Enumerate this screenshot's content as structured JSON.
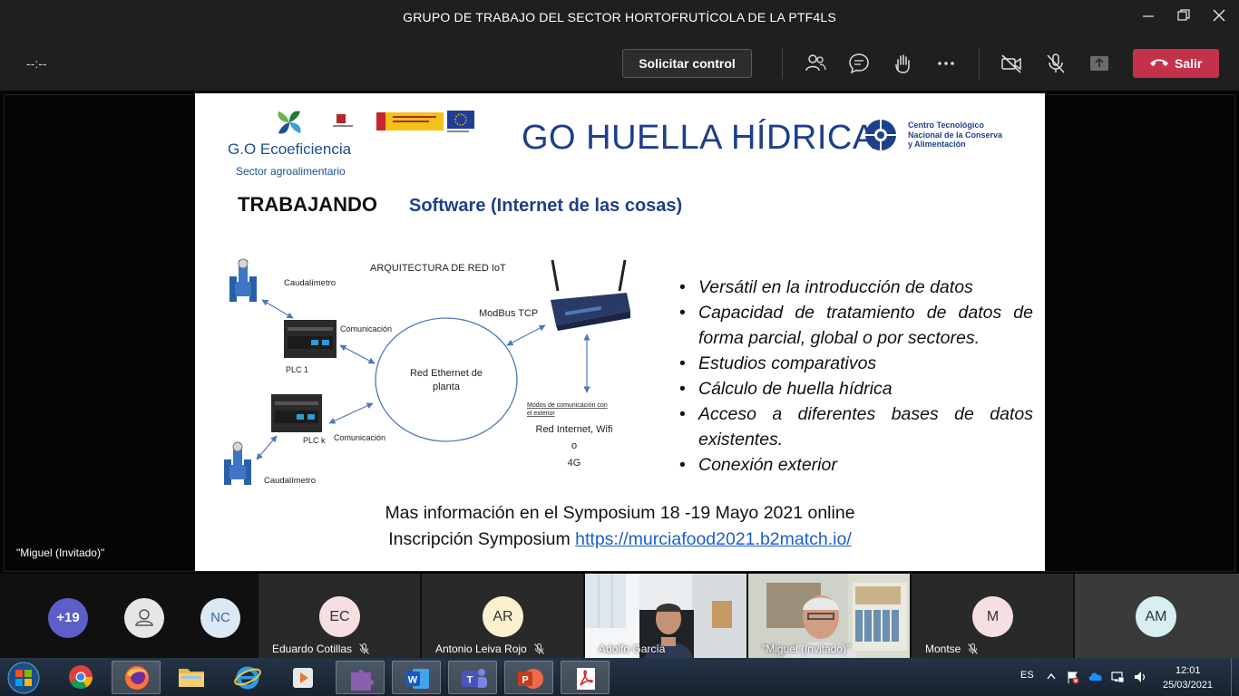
{
  "window": {
    "title": "GRUPO DE TRABAJO DEL SECTOR HORTOFRUTÍCOLA DE LA PTF4LS"
  },
  "toolbar": {
    "timer": "--:--",
    "request_control": "Solicitar control",
    "leave": "Salir"
  },
  "presenter": {
    "name": "\"Miguel (Invitado)\""
  },
  "slide": {
    "org_name": "G.O Ecoeficiencia",
    "org_sub": "Sector agroalimentario",
    "title": "GO HUELLA HÍDRICA",
    "partner": [
      "Centro Tecnológico",
      "Nacional de la Conserva",
      "y Alimentación"
    ],
    "section": "TRABAJANDO",
    "subtitle": "Software (Internet de las cosas)",
    "diagram": {
      "heading": "ARQUITECTURA DE RED IoT",
      "caudalimetro_top": "Caudalímetro",
      "comunicacion_top": "Comunicación",
      "plc1": "PLC 1",
      "network": [
        "Red Ethernet de",
        "planta"
      ],
      "modbus": "ModBus TCP",
      "modes_title": [
        "Modos de comunicación con",
        "el exterior"
      ],
      "modes": [
        "Red Internet, Wifi",
        "o",
        "4G"
      ],
      "plck": "PLC k",
      "comunicacion_bottom": "Comunicación",
      "caudalimetro_bottom": "Caudalímetro"
    },
    "bullets": [
      "Versátil en la introducción de datos",
      "Capacidad de tratamiento de datos de forma parcial, global o por sectores.",
      "Estudios comparativos",
      "Cálculo de huella hídrica",
      "Acceso a diferentes bases de datos existentes.",
      "Conexión exterior"
    ],
    "info_line1": "Mas información en el Symposium  18 -19 Mayo 2021 online",
    "info_line2_prefix": "Inscripción Symposium ",
    "info_link": "https://murciafood2021.b2match.io/"
  },
  "participants": {
    "overflow": "+19",
    "nc": "NC",
    "tiles": [
      {
        "initials": "EC",
        "name": "Eduardo Cotillas",
        "muted": true
      },
      {
        "initials": "AR",
        "name": "Antonio Leiva Rojo",
        "muted": true
      },
      {
        "initials": "",
        "name": "Adolfo García",
        "muted": false
      },
      {
        "initials": "",
        "name": "\"Miguel (Invitado)\"",
        "muted": false
      },
      {
        "initials": "M",
        "name": "Montse",
        "muted": true
      },
      {
        "initials": "AM",
        "name": "",
        "muted": false
      }
    ]
  },
  "taskbar": {
    "lang": "ES",
    "time": "12:01",
    "date": "25/03/2021"
  },
  "colors": {
    "leave": "#c4314b",
    "slide_title": "#1d3f8c",
    "link": "#1a5fc9"
  }
}
